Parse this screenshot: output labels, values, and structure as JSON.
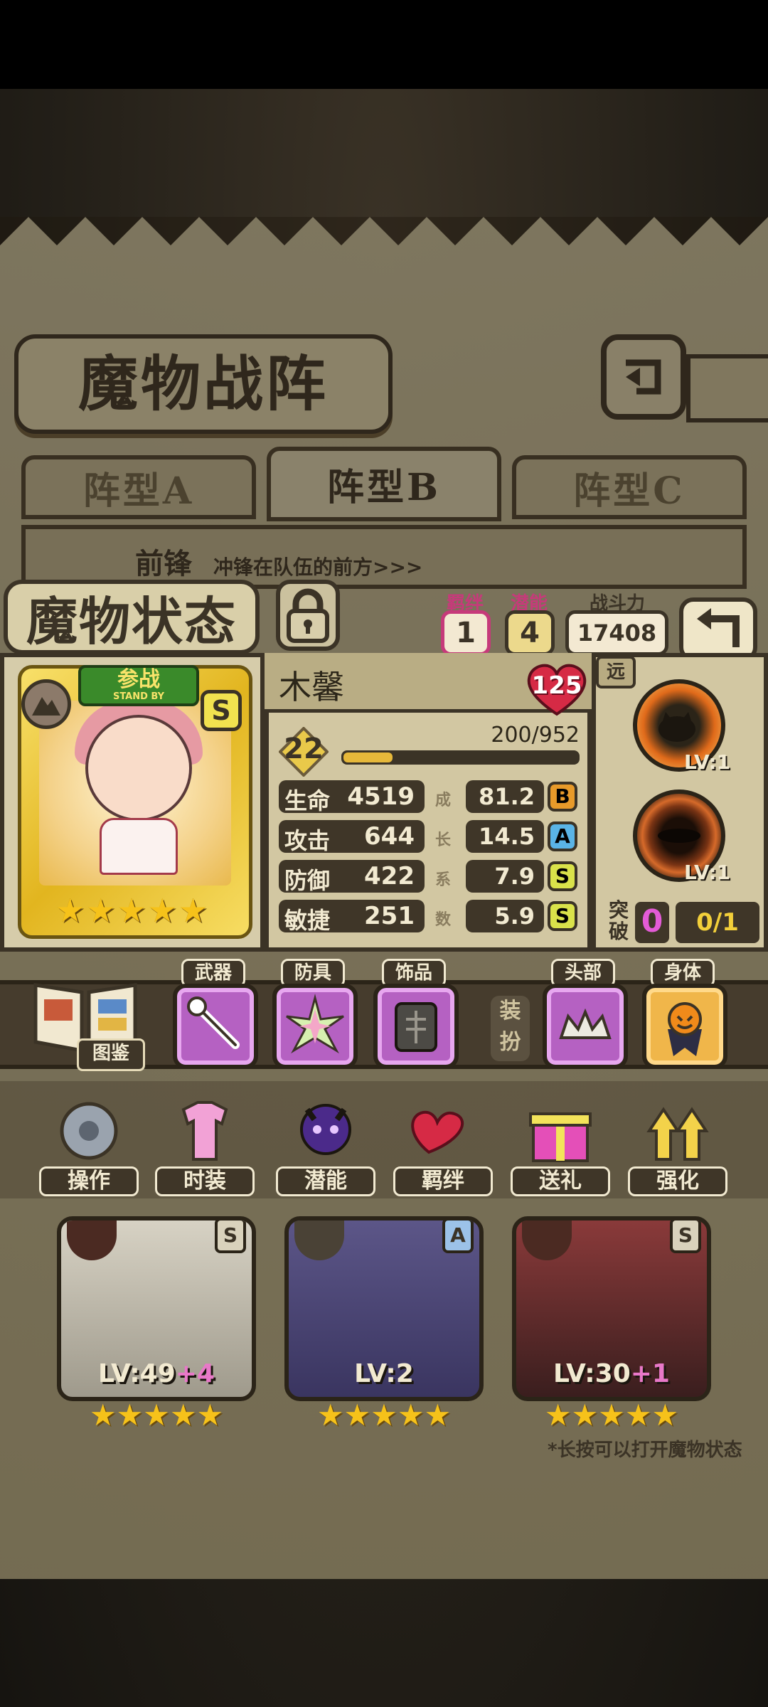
{
  "screen": {
    "title": "魔物战阵",
    "formation_tabs": [
      "阵型A",
      "阵型B",
      "阵型C"
    ],
    "active_tab": "阵型B",
    "front_label": "前锋",
    "front_desc": "冲锋在队伍的前方>>>"
  },
  "status": {
    "title": "魔物状态",
    "bond_label": "羁绊",
    "bond_value": "1",
    "potential_label": "潜能",
    "potential_value": "4",
    "power_label": "战斗力",
    "power_value": "17408"
  },
  "character": {
    "name": "木馨",
    "affection": "125",
    "standby_cn": "参战",
    "standby_en": "STAND BY",
    "rank": "S",
    "level": "22",
    "xp_text": "200/952",
    "xp_fraction": 0.21,
    "stars": 5,
    "stats": [
      {
        "label": "生命",
        "value": "4519",
        "growth": "81.2",
        "grade": "B"
      },
      {
        "label": "攻击",
        "value": "644",
        "growth": "14.5",
        "grade": "A"
      },
      {
        "label": "防御",
        "value": "422",
        "growth": "7.9",
        "grade": "S"
      },
      {
        "label": "敏捷",
        "value": "251",
        "growth": "5.9",
        "grade": "S"
      }
    ],
    "growth_vertical": [
      "成",
      "长",
      "系",
      "数"
    ]
  },
  "skills": {
    "range": "远",
    "items": [
      {
        "level": "LV:1"
      },
      {
        "level": "LV:1"
      }
    ],
    "breakthrough_label": "突破",
    "breakthrough_value": "0",
    "breakthrough_progress": "0/1"
  },
  "equipment": {
    "catalog_label": "图鉴",
    "slots": [
      {
        "tag": "武器"
      },
      {
        "tag": "防具"
      },
      {
        "tag": "饰品"
      },
      {
        "tag": "头部"
      },
      {
        "tag": "身体"
      }
    ],
    "dress_label": "装扮"
  },
  "actions": [
    "操作",
    "时装",
    "潜能",
    "羁绊",
    "送礼",
    "强化"
  ],
  "roster": [
    {
      "level": "LV:49",
      "plus": "+4",
      "grade": "S"
    },
    {
      "level": "LV:2",
      "plus": "",
      "grade": "A"
    },
    {
      "level": "LV:30",
      "plus": "+1",
      "grade": "S"
    }
  ],
  "hint": "*长按可以打开魔物状态",
  "colors": {
    "grade_B": "#e79a2a",
    "grade_A": "#5ab4e6",
    "grade_S": "#d9e24a",
    "bond": "#c63a7a"
  }
}
